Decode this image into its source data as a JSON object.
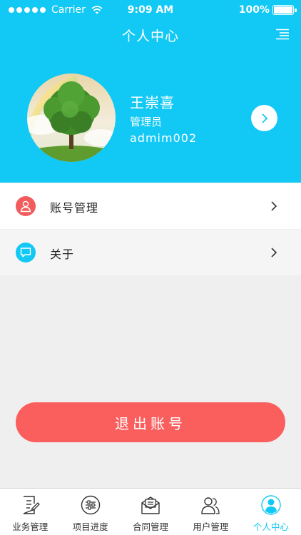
{
  "status_bar": {
    "carrier": "Carrier",
    "time": "9:09 AM",
    "battery": "100%"
  },
  "nav": {
    "title": "个人中心",
    "menu_icon": "menu-list-icon"
  },
  "profile": {
    "name": "王崇喜",
    "role": "管理员",
    "account_id": "admim002",
    "avatar_icon": "tree-avatar",
    "detail_icon": "chevron-right-icon"
  },
  "menu": {
    "items": [
      {
        "label": "账号管理",
        "icon": "user-icon",
        "icon_color": "#f25c5c"
      },
      {
        "label": "关于",
        "icon": "chat-bubble-icon",
        "icon_color": "#12c8f4"
      }
    ]
  },
  "logout": {
    "label": "退出账号"
  },
  "tabbar": {
    "active_index": 4,
    "tabs": [
      {
        "label": "业务管理",
        "icon": "document-edit-icon"
      },
      {
        "label": "项目进度",
        "icon": "sliders-icon"
      },
      {
        "label": "合同管理",
        "icon": "envelope-icon"
      },
      {
        "label": "用户管理",
        "icon": "users-icon"
      },
      {
        "label": "个人中心",
        "icon": "person-icon"
      }
    ]
  },
  "colors": {
    "primary": "#12c8f4",
    "danger": "#fa5f5e",
    "background": "#f0efef"
  }
}
